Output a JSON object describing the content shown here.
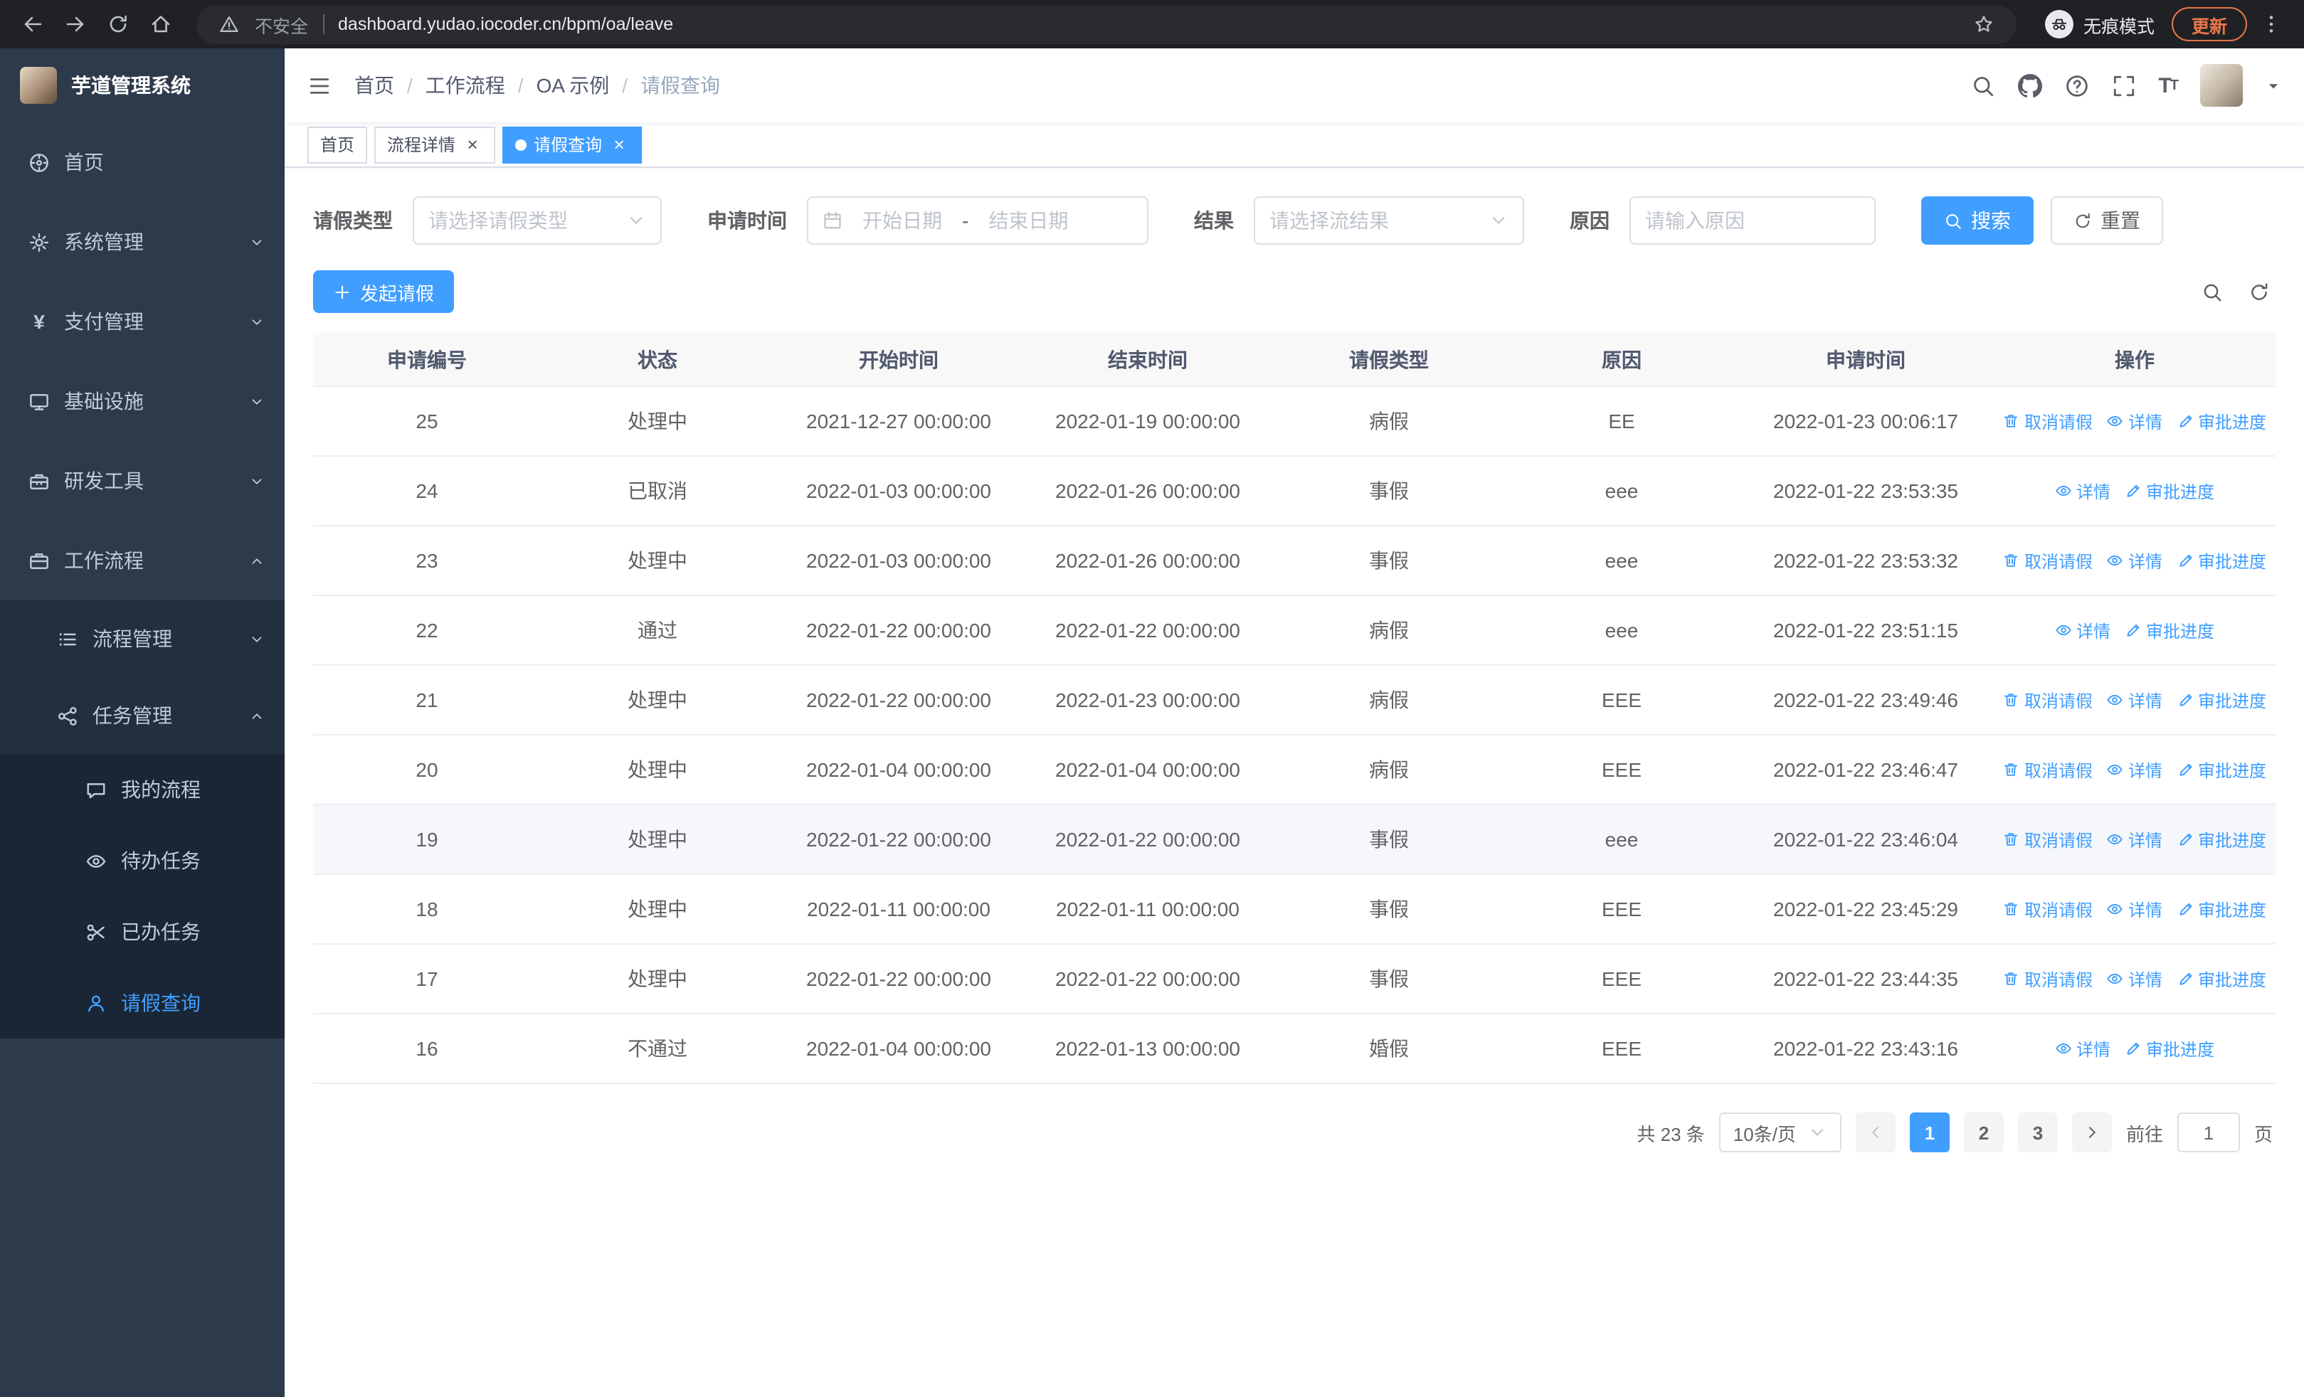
{
  "browser": {
    "security_warning": "不安全",
    "url": "dashboard.yudao.iocoder.cn/bpm/oa/leave",
    "incognito_label": "无痕模式",
    "update_label": "更新"
  },
  "sidebar": {
    "logo_title": "芋道管理系统",
    "menu": [
      {
        "key": "home",
        "label": "首页",
        "icon": "dashboard-icon",
        "expandable": false
      },
      {
        "key": "system",
        "label": "系统管理",
        "icon": "gear-icon",
        "expandable": true,
        "expanded": false
      },
      {
        "key": "payment",
        "label": "支付管理",
        "icon": "yen-icon",
        "expandable": true,
        "expanded": false
      },
      {
        "key": "infrastructure",
        "label": "基础设施",
        "icon": "monitor-icon",
        "expandable": true,
        "expanded": false
      },
      {
        "key": "dev-tools",
        "label": "研发工具",
        "icon": "toolbox-icon",
        "expandable": true,
        "expanded": false
      },
      {
        "key": "workflow",
        "label": "工作流程",
        "icon": "briefcase-icon",
        "expandable": true,
        "expanded": true,
        "children": [
          {
            "key": "process-management",
            "label": "流程管理",
            "icon": "list-icon",
            "expandable": true,
            "expanded": false
          },
          {
            "key": "task-management",
            "label": "任务管理",
            "icon": "share-icon",
            "expandable": true,
            "expanded": true,
            "children": [
              {
                "key": "my-process",
                "label": "我的流程",
                "icon": "chat-icon"
              },
              {
                "key": "todo-task",
                "label": "待办任务",
                "icon": "eye-icon"
              },
              {
                "key": "done-task",
                "label": "已办任务",
                "icon": "scissors-icon"
              },
              {
                "key": "leave-query",
                "label": "请假查询",
                "icon": "user-icon",
                "active": true
              }
            ]
          }
        ]
      }
    ]
  },
  "header": {
    "breadcrumb": [
      "首页",
      "工作流程",
      "OA 示例",
      "请假查询"
    ],
    "right_icons": [
      "search-icon",
      "github-icon",
      "help-icon",
      "fullscreen-icon",
      "fontsize-icon"
    ]
  },
  "tabs": [
    {
      "key": "home",
      "label": "首页",
      "closable": false,
      "active": false
    },
    {
      "key": "process-detail",
      "label": "流程详情",
      "closable": true,
      "active": false
    },
    {
      "key": "leave-query",
      "label": "请假查询",
      "closable": true,
      "active": true
    }
  ],
  "filters": {
    "leave_type_label": "请假类型",
    "leave_type_placeholder": "请选择请假类型",
    "apply_time_label": "申请时间",
    "start_date_placeholder": "开始日期",
    "range_separator": "-",
    "end_date_placeholder": "结束日期",
    "result_label": "结果",
    "result_placeholder": "请选择流结果",
    "reason_label": "原因",
    "reason_placeholder": "请输入原因",
    "search_button": "搜索",
    "reset_button": "重置"
  },
  "toolbar": {
    "create_button": "发起请假"
  },
  "table": {
    "columns": [
      "申请编号",
      "状态",
      "开始时间",
      "结束时间",
      "请假类型",
      "原因",
      "申请时间",
      "操作"
    ],
    "action_labels": {
      "cancel": "取消请假",
      "detail": "详情",
      "progress": "审批进度"
    },
    "rows": [
      {
        "id": "25",
        "status": "处理中",
        "start": "2021-12-27 00:00:00",
        "end": "2022-01-19 00:00:00",
        "type": "病假",
        "reason": "EE",
        "applied": "2022-01-23 00:06:17",
        "actions": [
          "cancel",
          "detail",
          "progress"
        ],
        "highlight": false
      },
      {
        "id": "24",
        "status": "已取消",
        "start": "2022-01-03 00:00:00",
        "end": "2022-01-26 00:00:00",
        "type": "事假",
        "reason": "eee",
        "applied": "2022-01-22 23:53:35",
        "actions": [
          "detail",
          "progress"
        ],
        "highlight": false
      },
      {
        "id": "23",
        "status": "处理中",
        "start": "2022-01-03 00:00:00",
        "end": "2022-01-26 00:00:00",
        "type": "事假",
        "reason": "eee",
        "applied": "2022-01-22 23:53:32",
        "actions": [
          "cancel",
          "detail",
          "progress"
        ],
        "highlight": false
      },
      {
        "id": "22",
        "status": "通过",
        "start": "2022-01-22 00:00:00",
        "end": "2022-01-22 00:00:00",
        "type": "病假",
        "reason": "eee",
        "applied": "2022-01-22 23:51:15",
        "actions": [
          "detail",
          "progress"
        ],
        "highlight": false
      },
      {
        "id": "21",
        "status": "处理中",
        "start": "2022-01-22 00:00:00",
        "end": "2022-01-23 00:00:00",
        "type": "病假",
        "reason": "EEE",
        "applied": "2022-01-22 23:49:46",
        "actions": [
          "cancel",
          "detail",
          "progress"
        ],
        "highlight": false
      },
      {
        "id": "20",
        "status": "处理中",
        "start": "2022-01-04 00:00:00",
        "end": "2022-01-04 00:00:00",
        "type": "病假",
        "reason": "EEE",
        "applied": "2022-01-22 23:46:47",
        "actions": [
          "cancel",
          "detail",
          "progress"
        ],
        "highlight": false
      },
      {
        "id": "19",
        "status": "处理中",
        "start": "2022-01-22 00:00:00",
        "end": "2022-01-22 00:00:00",
        "type": "事假",
        "reason": "eee",
        "applied": "2022-01-22 23:46:04",
        "actions": [
          "cancel",
          "detail",
          "progress"
        ],
        "highlight": true
      },
      {
        "id": "18",
        "status": "处理中",
        "start": "2022-01-11 00:00:00",
        "end": "2022-01-11 00:00:00",
        "type": "事假",
        "reason": "EEE",
        "applied": "2022-01-22 23:45:29",
        "actions": [
          "cancel",
          "detail",
          "progress"
        ],
        "highlight": false
      },
      {
        "id": "17",
        "status": "处理中",
        "start": "2022-01-22 00:00:00",
        "end": "2022-01-22 00:00:00",
        "type": "事假",
        "reason": "EEE",
        "applied": "2022-01-22 23:44:35",
        "actions": [
          "cancel",
          "detail",
          "progress"
        ],
        "highlight": false
      },
      {
        "id": "16",
        "status": "不通过",
        "start": "2022-01-04 00:00:00",
        "end": "2022-01-13 00:00:00",
        "type": "婚假",
        "reason": "EEE",
        "applied": "2022-01-22 23:43:16",
        "actions": [
          "detail",
          "progress"
        ],
        "highlight": false
      }
    ]
  },
  "pagination": {
    "total_text": "共 23 条",
    "page_size": "10条/页",
    "pages": [
      "1",
      "2",
      "3"
    ],
    "active_page": "1",
    "goto_label": "前往",
    "goto_value": "1",
    "goto_suffix": "页"
  },
  "colors": {
    "primary": "#409eff",
    "sidebar_bg": "#2d3a4b",
    "update_accent": "#e8754a"
  }
}
